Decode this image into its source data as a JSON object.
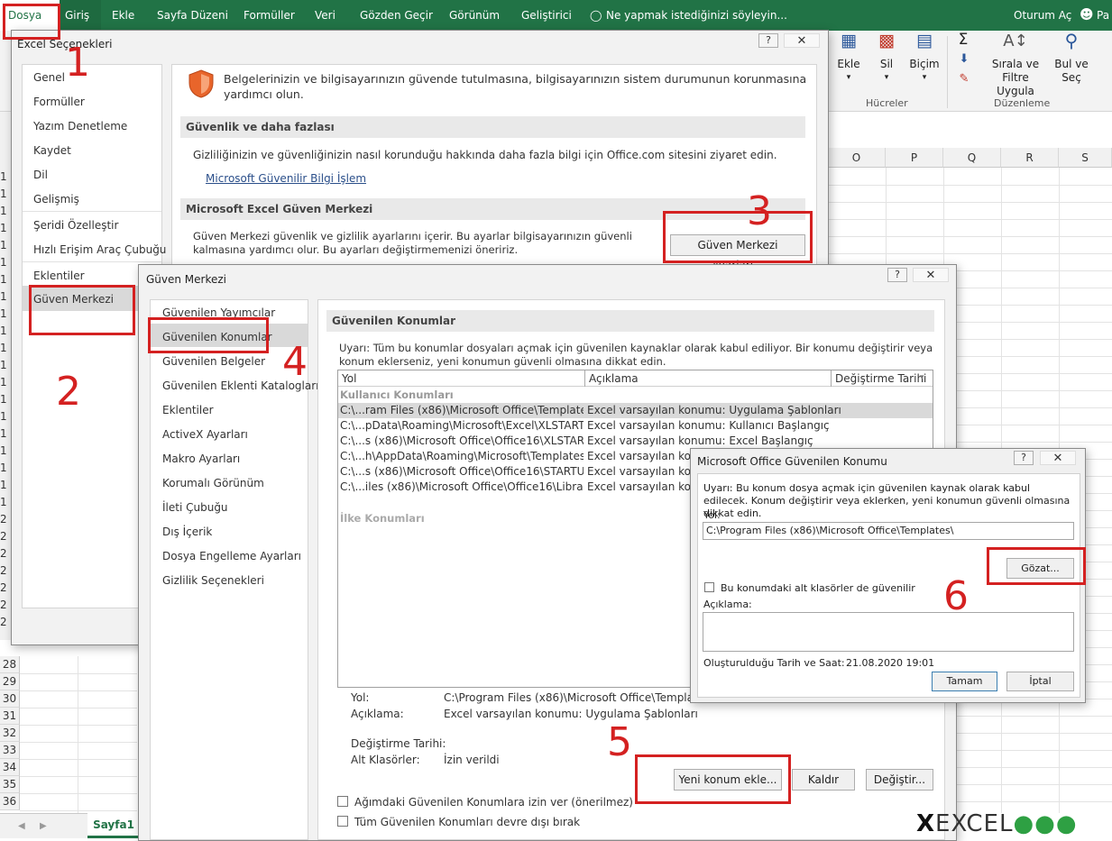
{
  "ribbon": {
    "tabs": [
      "Dosya",
      "Giriş",
      "Ekle",
      "Sayfa Düzeni",
      "Formüller",
      "Veri",
      "Gözden Geçir",
      "Görünüm",
      "Geliştirici"
    ],
    "tell_me": "Ne yapmak istediğinizi söyleyin...",
    "sign_in": "Oturum Aç",
    "user_short": "Pa",
    "commands": {
      "insert": "Ekle",
      "delete": "Sil",
      "format": "Biçim",
      "sort_filter_1": "Sırala ve Filtre",
      "sort_filter_2": "Uygula",
      "find_1": "Bul ve",
      "find_2": "Seç"
    },
    "groups": {
      "cells": "Hücreler",
      "editing": "Düzenleme"
    }
  },
  "sheet": {
    "columns": [
      "O",
      "P",
      "Q",
      "R",
      "S"
    ],
    "rows": [
      "28",
      "29",
      "30",
      "31",
      "32",
      "33",
      "34",
      "35",
      "36"
    ],
    "partial_rows": [
      "1",
      "1",
      "1",
      "1",
      "1",
      "1",
      "1",
      "1",
      "1",
      "1",
      "1",
      "1",
      "1",
      "1",
      "1",
      "1",
      "1",
      "1",
      "1",
      "1",
      "2",
      "2",
      "2",
      "2",
      "2",
      "2",
      "2"
    ],
    "tab": "Sayfa1"
  },
  "excel_options": {
    "title": "Excel Seçenekleri",
    "nav": [
      "Genel",
      "Formüller",
      "Yazım Denetleme",
      "Kaydet",
      "Dil",
      "Gelişmiş",
      "Şeridi Özelleştir",
      "Hızlı Erişim Araç Çubuğu",
      "Eklentiler",
      "Güven Merkezi"
    ],
    "intro": "Belgelerinizin ve bilgisayarınızın güvende tutulmasına, bilgisayarınızın sistem durumunun korunmasına yardımcı olun.",
    "section1": "Güvenlik ve daha fazlası",
    "section1_text": "Gizliliğinizin ve güvenliğinizin nasıl korunduğu hakkında daha fazla bilgi için Office.com sitesini ziyaret edin.",
    "link": "Microsoft Güvenilir Bilgi İşlem",
    "section2": "Microsoft Excel Güven Merkezi",
    "section2_text": "Güven Merkezi güvenlik ve gizlilik ayarlarını içerir. Bu ayarlar bilgisayarınızın güvenli kalmasına yardımcı olur. Bu ayarları değiştirmemenizi öneririz.",
    "tc_button": "Güven Merkezi Ayarları..."
  },
  "trust_center": {
    "title": "Güven Merkezi",
    "nav": [
      "Güvenilen Yayımcılar",
      "Güvenilen Konumlar",
      "Güvenilen Belgeler",
      "Güvenilen Eklenti Katalogları",
      "Eklentiler",
      "ActiveX Ayarları",
      "Makro Ayarları",
      "Korumalı Görünüm",
      "İleti Çubuğu",
      "Dış İçerik",
      "Dosya Engelleme Ayarları",
      "Gizlilik Seçenekleri"
    ],
    "heading": "Güvenilen Konumlar",
    "warning": "Uyarı: Tüm bu konumlar dosyaları açmak için güvenilen kaynaklar olarak kabul ediliyor. Bir konumu değiştirir veya konum eklerseniz, yeni konumun güvenli olmasına dikkat edin.",
    "col_path": "Yol",
    "col_desc": "Açıklama",
    "col_date": "Değiştirme Tarihi",
    "group_user": "Kullanıcı Konumları",
    "group_policy": "İlke Konumları",
    "locations": [
      {
        "path": "C:\\...ram Files (x86)\\Microsoft Office\\Templates\\",
        "desc": "Excel varsayılan konumu: Uygulama Şablonları"
      },
      {
        "path": "C:\\...pData\\Roaming\\Microsoft\\Excel\\XLSTART\\",
        "desc": "Excel varsayılan konumu: Kullanıcı Başlangıç"
      },
      {
        "path": "C:\\...s (x86)\\Microsoft Office\\Office16\\XLSTART\\",
        "desc": "Excel varsayılan konumu: Excel Başlangıç"
      },
      {
        "path": "C:\\...h\\AppData\\Roaming\\Microsoft\\Templates\\",
        "desc": "Excel varsayılan konumu"
      },
      {
        "path": "C:\\...s (x86)\\Microsoft Office\\Office16\\STARTUP\\",
        "desc": "Excel varsayılan konu"
      },
      {
        "path": "C:\\...iles (x86)\\Microsoft Office\\Office16\\Library\\",
        "desc": "Excel varsayılan konu"
      }
    ],
    "detail_path_label": "Yol:",
    "detail_path": "C:\\Program Files (x86)\\Microsoft Office\\Templates\\",
    "detail_desc_label": "Açıklama:",
    "detail_desc": "Excel varsayılan konumu: Uygulama Şablonları",
    "detail_date_label": "Değiştirme Tarihi:",
    "detail_sub_label": "Alt Klasörler:",
    "detail_sub": "İzin verildi",
    "add_button": "Yeni konum ekle...",
    "remove_button": "Kaldır",
    "modify_button": "Değiştir...",
    "allow_network": "Ağımdaki Güvenilen Konumlara izin ver (önerilmez)",
    "disable_all": "Tüm Güvenilen Konumları devre dışı bırak"
  },
  "location_dialog": {
    "title": "Microsoft Office Güvenilen Konumu",
    "warning": "Uyarı: Bu konum dosya açmak için güvenilen kaynak olarak kabul edilecek. Konum değiştirir veya eklerken, yeni konumun güvenli olmasına dikkat edin.",
    "path_label": "Yol:",
    "path_value": "C:\\Program Files (x86)\\Microsoft Office\\Templates\\",
    "browse": "Gözat...",
    "subfolders": "Bu konumdaki alt klasörler de güvenilir",
    "desc_label": "Açıklama:",
    "created": "Oluşturulduğu Tarih ve Saat:",
    "created_value": "21.08.2020 19:01",
    "ok": "Tamam",
    "cancel": "İptal"
  },
  "callouts": [
    "1",
    "2",
    "3",
    "4",
    "5",
    "6"
  ],
  "watermark": "EXCEL",
  "colors": {
    "ribbon": "#217346",
    "callout": "#d42121",
    "selected": "#d9d9d9"
  }
}
